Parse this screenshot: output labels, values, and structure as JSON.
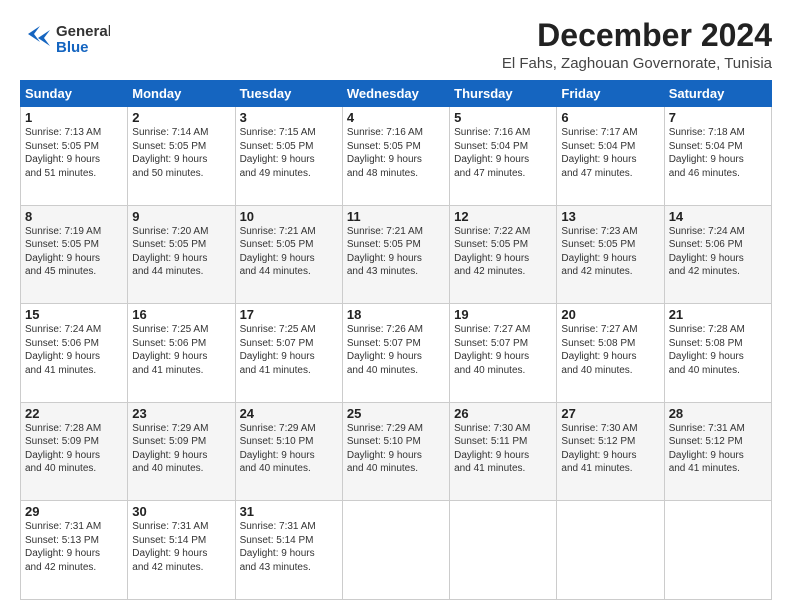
{
  "header": {
    "logo_general": "General",
    "logo_blue": "Blue",
    "month_title": "December 2024",
    "location": "El Fahs, Zaghouan Governorate, Tunisia"
  },
  "weekdays": [
    "Sunday",
    "Monday",
    "Tuesday",
    "Wednesday",
    "Thursday",
    "Friday",
    "Saturday"
  ],
  "weeks": [
    [
      {
        "day": "1",
        "sunrise": "7:13 AM",
        "sunset": "5:05 PM",
        "daylight": "9 hours and 51 minutes."
      },
      {
        "day": "2",
        "sunrise": "7:14 AM",
        "sunset": "5:05 PM",
        "daylight": "9 hours and 50 minutes."
      },
      {
        "day": "3",
        "sunrise": "7:15 AM",
        "sunset": "5:05 PM",
        "daylight": "9 hours and 49 minutes."
      },
      {
        "day": "4",
        "sunrise": "7:16 AM",
        "sunset": "5:05 PM",
        "daylight": "9 hours and 48 minutes."
      },
      {
        "day": "5",
        "sunrise": "7:16 AM",
        "sunset": "5:04 PM",
        "daylight": "9 hours and 47 minutes."
      },
      {
        "day": "6",
        "sunrise": "7:17 AM",
        "sunset": "5:04 PM",
        "daylight": "9 hours and 47 minutes."
      },
      {
        "day": "7",
        "sunrise": "7:18 AM",
        "sunset": "5:04 PM",
        "daylight": "9 hours and 46 minutes."
      }
    ],
    [
      {
        "day": "8",
        "sunrise": "7:19 AM",
        "sunset": "5:05 PM",
        "daylight": "9 hours and 45 minutes."
      },
      {
        "day": "9",
        "sunrise": "7:20 AM",
        "sunset": "5:05 PM",
        "daylight": "9 hours and 44 minutes."
      },
      {
        "day": "10",
        "sunrise": "7:21 AM",
        "sunset": "5:05 PM",
        "daylight": "9 hours and 44 minutes."
      },
      {
        "day": "11",
        "sunrise": "7:21 AM",
        "sunset": "5:05 PM",
        "daylight": "9 hours and 43 minutes."
      },
      {
        "day": "12",
        "sunrise": "7:22 AM",
        "sunset": "5:05 PM",
        "daylight": "9 hours and 42 minutes."
      },
      {
        "day": "13",
        "sunrise": "7:23 AM",
        "sunset": "5:05 PM",
        "daylight": "9 hours and 42 minutes."
      },
      {
        "day": "14",
        "sunrise": "7:24 AM",
        "sunset": "5:06 PM",
        "daylight": "9 hours and 42 minutes."
      }
    ],
    [
      {
        "day": "15",
        "sunrise": "7:24 AM",
        "sunset": "5:06 PM",
        "daylight": "9 hours and 41 minutes."
      },
      {
        "day": "16",
        "sunrise": "7:25 AM",
        "sunset": "5:06 PM",
        "daylight": "9 hours and 41 minutes."
      },
      {
        "day": "17",
        "sunrise": "7:25 AM",
        "sunset": "5:07 PM",
        "daylight": "9 hours and 41 minutes."
      },
      {
        "day": "18",
        "sunrise": "7:26 AM",
        "sunset": "5:07 PM",
        "daylight": "9 hours and 40 minutes."
      },
      {
        "day": "19",
        "sunrise": "7:27 AM",
        "sunset": "5:07 PM",
        "daylight": "9 hours and 40 minutes."
      },
      {
        "day": "20",
        "sunrise": "7:27 AM",
        "sunset": "5:08 PM",
        "daylight": "9 hours and 40 minutes."
      },
      {
        "day": "21",
        "sunrise": "7:28 AM",
        "sunset": "5:08 PM",
        "daylight": "9 hours and 40 minutes."
      }
    ],
    [
      {
        "day": "22",
        "sunrise": "7:28 AM",
        "sunset": "5:09 PM",
        "daylight": "9 hours and 40 minutes."
      },
      {
        "day": "23",
        "sunrise": "7:29 AM",
        "sunset": "5:09 PM",
        "daylight": "9 hours and 40 minutes."
      },
      {
        "day": "24",
        "sunrise": "7:29 AM",
        "sunset": "5:10 PM",
        "daylight": "9 hours and 40 minutes."
      },
      {
        "day": "25",
        "sunrise": "7:29 AM",
        "sunset": "5:10 PM",
        "daylight": "9 hours and 40 minutes."
      },
      {
        "day": "26",
        "sunrise": "7:30 AM",
        "sunset": "5:11 PM",
        "daylight": "9 hours and 41 minutes."
      },
      {
        "day": "27",
        "sunrise": "7:30 AM",
        "sunset": "5:12 PM",
        "daylight": "9 hours and 41 minutes."
      },
      {
        "day": "28",
        "sunrise": "7:31 AM",
        "sunset": "5:12 PM",
        "daylight": "9 hours and 41 minutes."
      }
    ],
    [
      {
        "day": "29",
        "sunrise": "7:31 AM",
        "sunset": "5:13 PM",
        "daylight": "9 hours and 42 minutes."
      },
      {
        "day": "30",
        "sunrise": "7:31 AM",
        "sunset": "5:14 PM",
        "daylight": "9 hours and 42 minutes."
      },
      {
        "day": "31",
        "sunrise": "7:31 AM",
        "sunset": "5:14 PM",
        "daylight": "9 hours and 43 minutes."
      },
      null,
      null,
      null,
      null
    ]
  ]
}
